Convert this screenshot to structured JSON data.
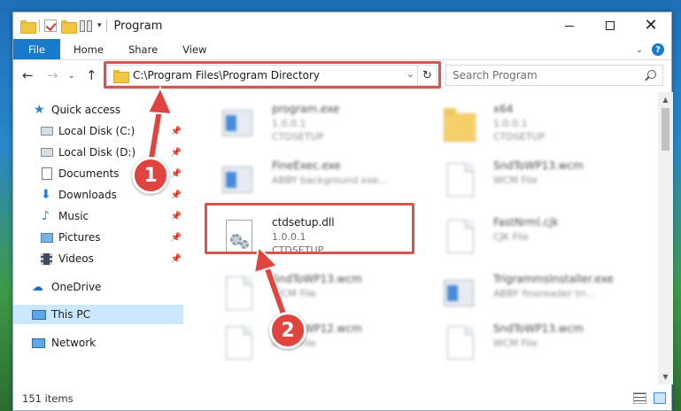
{
  "window": {
    "title": "Program",
    "controls": {
      "minimize": "minimize",
      "maximize": "maximize",
      "close": "✕"
    }
  },
  "ribbon": {
    "tabs": [
      "File",
      "Home",
      "Share",
      "View"
    ]
  },
  "address": {
    "path": "C:\\Program Files\\Program Directory",
    "search_placeholder": "Search Program"
  },
  "nav": {
    "items": [
      {
        "label": "Quick access",
        "icon": "star-icon",
        "pinned": false
      },
      {
        "label": "Local Disk (C:)",
        "icon": "disk-icon",
        "pinned": true
      },
      {
        "label": "Local Disk (D:)",
        "icon": "disk-icon",
        "pinned": true
      },
      {
        "label": "Documents",
        "icon": "documents-icon",
        "pinned": true
      },
      {
        "label": "Downloads",
        "icon": "downloads-icon",
        "pinned": true
      },
      {
        "label": "Music",
        "icon": "music-icon",
        "pinned": true
      },
      {
        "label": "Pictures",
        "icon": "pictures-icon",
        "pinned": true
      },
      {
        "label": "Videos",
        "icon": "videos-icon",
        "pinned": true
      },
      {
        "label": "OneDrive",
        "icon": "onedrive-icon",
        "pinned": false
      },
      {
        "label": "This PC",
        "icon": "this-pc-icon",
        "pinned": false,
        "selected": true
      },
      {
        "label": "Network",
        "icon": "network-icon",
        "pinned": false
      }
    ]
  },
  "files": [
    {
      "name": "program.exe",
      "line2": "1.0.0.1",
      "line3": "CTDSETUP",
      "icon": "exe-icon",
      "blurred": true
    },
    {
      "name": "x64",
      "line2": "1.0.0.1",
      "line3": "CTDSETUP",
      "icon": "folder-icon",
      "blurred": true
    },
    {
      "name": "FineExec.exe",
      "line2": "ABBY background exe...",
      "line3": "",
      "icon": "exe-icon",
      "blurred": true
    },
    {
      "name": "SndToWP13.wcm",
      "line2": "WCM File",
      "line3": "",
      "icon": "file-icon",
      "blurred": true
    },
    {
      "name": "ctdsetup.dll",
      "line2": "1.0.0.1",
      "line3": "CTDSETUP",
      "icon": "dll-icon",
      "blurred": false
    },
    {
      "name": "FastNrml.cjk",
      "line2": "CJK File",
      "line3": "",
      "icon": "file-icon",
      "blurred": true
    },
    {
      "name": "SndToWP13.wcm",
      "line2": "WCM File",
      "line3": "",
      "icon": "file-icon",
      "blurred": true
    },
    {
      "name": "TrigrammsInstaller.exe",
      "line2": "ABBY finereader tri...",
      "line3": "",
      "icon": "exe-icon",
      "blurred": true
    },
    {
      "name": "SndToWP12.wcm",
      "line2": "WCM File",
      "line3": "",
      "icon": "file-icon",
      "blurred": true
    },
    {
      "name": "SndToWP13.wcm",
      "line2": "WCM File",
      "line3": "",
      "icon": "file-icon",
      "blurred": true
    }
  ],
  "status": {
    "count": "151 items"
  },
  "callouts": {
    "step1": "1",
    "step2": "2"
  },
  "colors": {
    "accent": "#1979ca",
    "highlight": "#d9534f",
    "badge": "#e0443e",
    "selected": "#cce8ff"
  }
}
